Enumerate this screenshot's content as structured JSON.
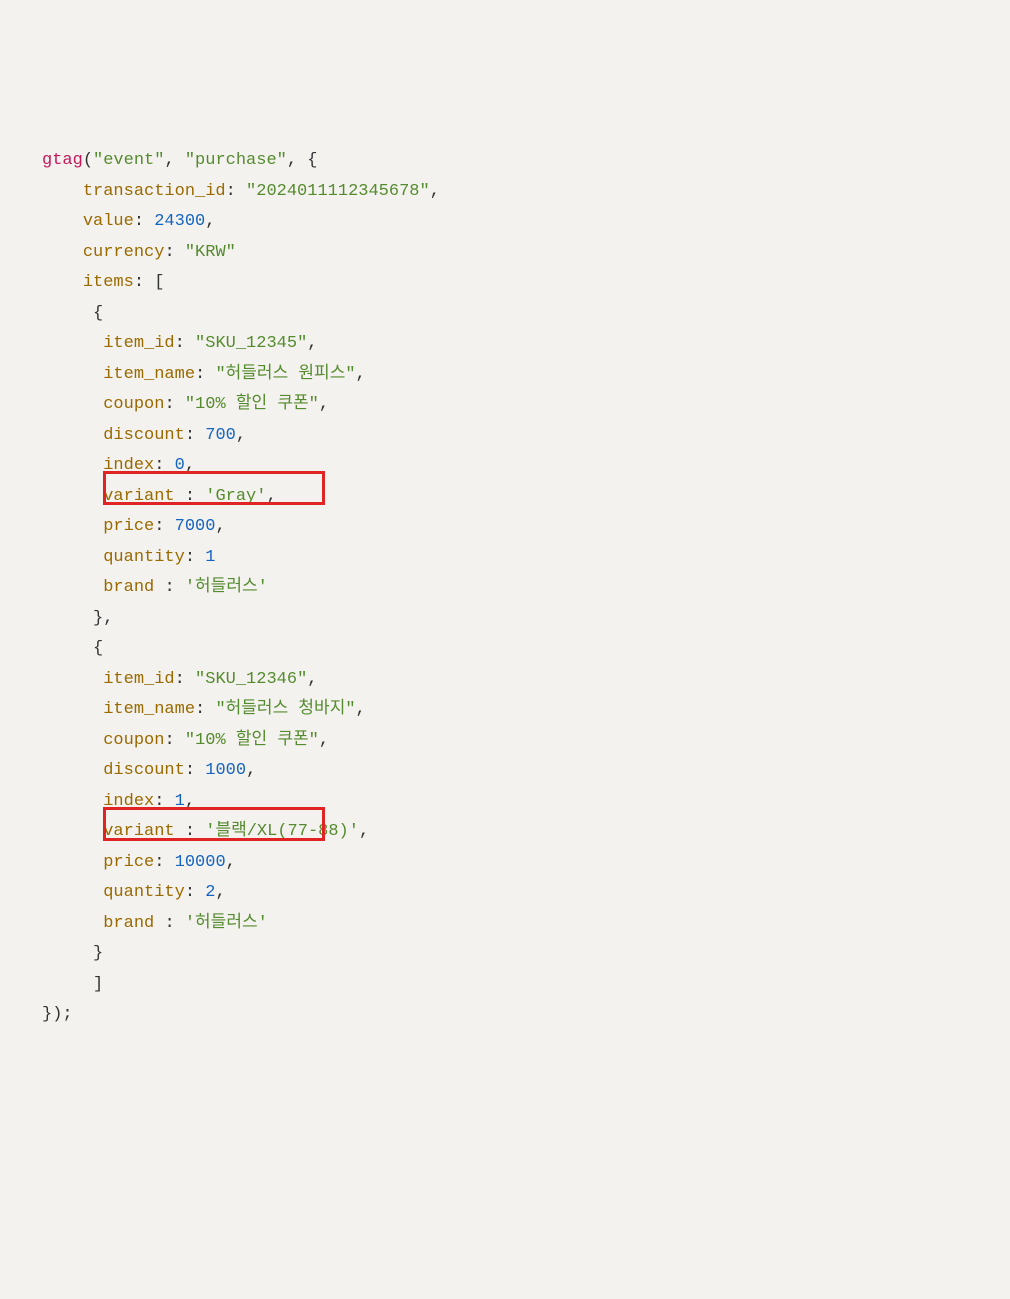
{
  "code": {
    "fn": "gtag",
    "paren_open": "(",
    "event_str": "\"event\"",
    "comma": ",",
    "sp": " ",
    "purchase_str": "\"purchase\"",
    "brace_open": "{",
    "brace_close": "}",
    "bracket_open": "[",
    "bracket_close": "]",
    "paren_close_semi": ");",
    "transaction_id_key": "transaction_id",
    "transaction_id_val": "\"2024011112345678\"",
    "value_key": "value",
    "value_val": "24300",
    "currency_key": "currency",
    "currency_val": "\"KRW\"",
    "items_key": "items",
    "items": [
      {
        "item_id_key": "item_id",
        "item_id_val": "\"SKU_12345\"",
        "item_name_key": "item_name",
        "item_name_val": "\"허들러스 원피스\"",
        "coupon_key": "coupon",
        "coupon_val": "\"10% 할인 쿠폰\"",
        "discount_key": "discount",
        "discount_val": "700",
        "index_key": "index",
        "index_val": "0",
        "variant_key": "variant ",
        "variant_val": "'Gray'",
        "price_key": "price",
        "price_val": "7000",
        "quantity_key": "quantity",
        "quantity_val": "1",
        "brand_key": "brand ",
        "brand_val": "'허들러스'"
      },
      {
        "item_id_key": "item_id",
        "item_id_val": "\"SKU_12346\"",
        "item_name_key": "item_name",
        "item_name_val": "\"허들러스 청바지\"",
        "coupon_key": "coupon",
        "coupon_val": "\"10% 할인 쿠폰\"",
        "discount_key": "discount",
        "discount_val": "1000",
        "index_key": "index",
        "index_val": "1",
        "variant_key": "variant ",
        "variant_val": "'블랙/XL(77-88)'",
        "price_key": "price",
        "price_val": "10000",
        "quantity_key": "quantity",
        "quantity_val": "2",
        "brand_key": "brand ",
        "brand_val": "'허들러스'"
      }
    ]
  }
}
